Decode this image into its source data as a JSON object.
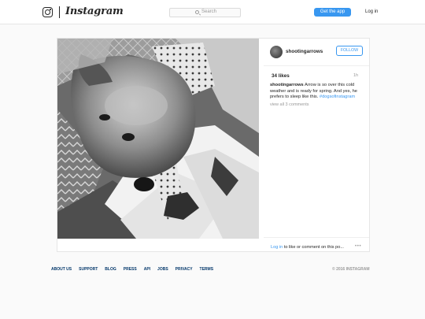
{
  "header": {
    "logo_icon": "instagram-camera-icon",
    "wordmark": "Instagram",
    "search": {
      "icon": "search-icon",
      "label": "Search"
    },
    "get_app_label": "Get the app",
    "login_label": "Log in",
    "colors": {
      "accent": "#3897f0",
      "text": "#262626",
      "muted": "#999999"
    }
  },
  "post": {
    "username": "shootingarrows",
    "follow_label": "FOLLOW",
    "likes": "34 likes",
    "time_ago": "1h",
    "caption": {
      "username": "shootingarrows",
      "text": "Arrow is so over this cold weather and is ready for spring. And yes, he prefers to sleep like this.",
      "hashtag": "#dogsofinstagram"
    },
    "view_all_comments": "view all 3 comments",
    "comment_prompt": {
      "login_link": "Log in",
      "rest": "to like or comment on this po..."
    },
    "more_icon": "more-options-icon"
  },
  "footer": {
    "links": [
      "ABOUT US",
      "SUPPORT",
      "BLOG",
      "PRESS",
      "API",
      "JOBS",
      "PRIVACY",
      "TERMS"
    ],
    "copyright": "© 2016 INSTAGRAM"
  }
}
